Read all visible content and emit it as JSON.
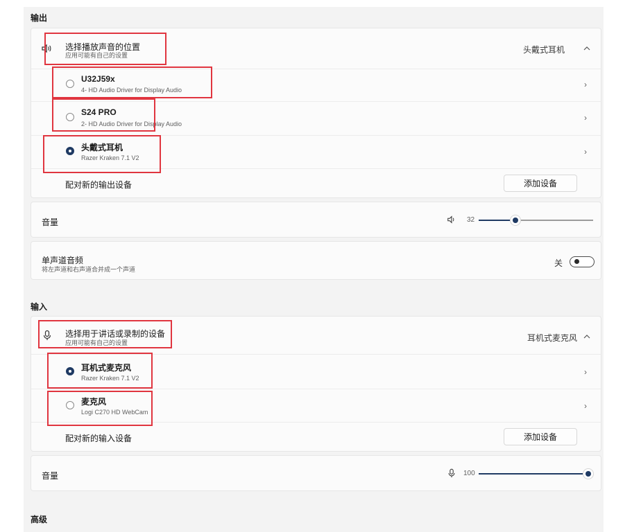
{
  "output": {
    "section_label": "输出",
    "device_header": {
      "title": "选择播放声音的位置",
      "subtitle": "应用可能有自己的设置",
      "current_device": "头戴式耳机",
      "icon": "speaker-icon",
      "expand_icon": "chevron-up-icon"
    },
    "devices": [
      {
        "name": "U32J59x",
        "detail": "4- HD Audio Driver for Display Audio",
        "selected": false
      },
      {
        "name": "S24 PRO",
        "detail": "2- HD Audio Driver for Display Audio",
        "selected": false
      },
      {
        "name": "头戴式耳机",
        "detail": "Razer Kraken 7.1 V2",
        "selected": true
      }
    ],
    "pair_new": {
      "label": "配对新的输出设备",
      "button_label": "添加设备"
    },
    "volume": {
      "label": "音量",
      "value": "32",
      "level": 0.32,
      "icon": "speaker-small-icon"
    },
    "mono": {
      "title": "单声道音频",
      "subtitle": "将左声道和右声道合并成一个声道",
      "state_label": "关",
      "on": false
    }
  },
  "input": {
    "section_label": "输入",
    "device_header": {
      "title": "选择用于讲话或录制的设备",
      "subtitle": "应用可能有自己的设置",
      "current_device": "耳机式麦克风",
      "icon": "microphone-icon",
      "expand_icon": "chevron-up-icon"
    },
    "devices": [
      {
        "name": "耳机式麦克风",
        "detail": "Razer Kraken 7.1 V2",
        "selected": true
      },
      {
        "name": "麦克风",
        "detail": "Logi C270 HD WebCam",
        "selected": false
      }
    ],
    "pair_new": {
      "label": "配对新的输入设备",
      "button_label": "添加设备"
    },
    "volume": {
      "label": "音量",
      "value": "100",
      "level": 1.0,
      "icon": "microphone-small-icon"
    }
  },
  "advanced": {
    "section_label": "高级"
  },
  "colors": {
    "accent": "#1f3a63",
    "highlight_box": "#e0353f"
  }
}
